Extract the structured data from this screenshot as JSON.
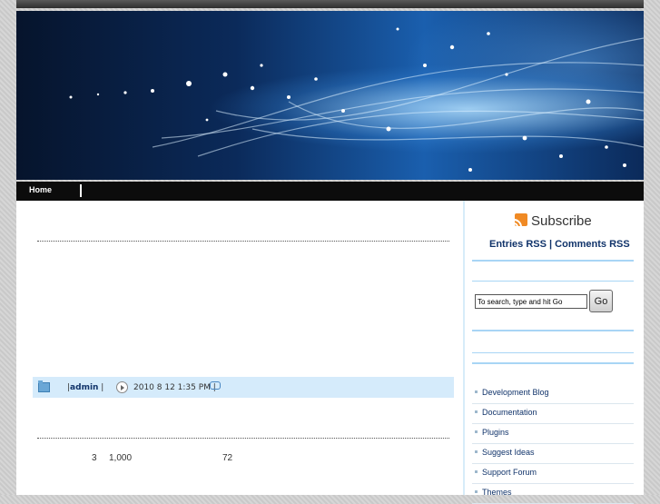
{
  "nav": {
    "home_label": "Home"
  },
  "post": {
    "author": "admin",
    "date": "2010 8 12  1:35 PM",
    "stats": [
      "3",
      "1,000",
      "72"
    ]
  },
  "sidebar": {
    "subscribe_label": "Subscribe",
    "entries_rss": "Entries RSS",
    "rss_separator": "|",
    "comments_rss": "Comments RSS",
    "search_placeholder": "To search, type and hit Go",
    "go_label": "Go",
    "links": [
      "Development Blog",
      "Documentation",
      "Plugins",
      "Suggest Ideas",
      "Support Forum",
      "Themes"
    ]
  },
  "colors": {
    "link": "#10336a",
    "accent_light": "#a8d5f5",
    "meta_bg": "#d5ebfb"
  }
}
